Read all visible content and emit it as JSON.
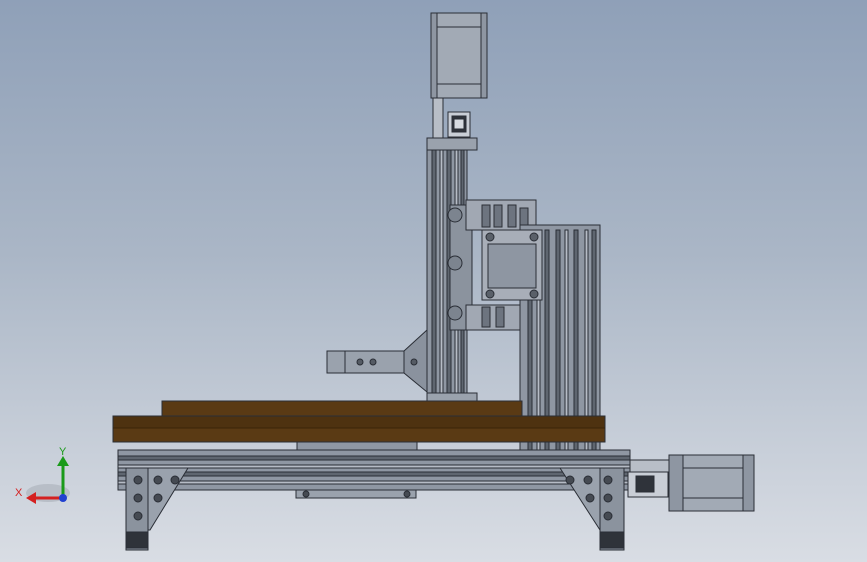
{
  "viewport": {
    "background_top": "#8fa0b8",
    "background_bottom": "#d9dde4",
    "model": "cnc-router-assembly"
  },
  "triad": {
    "x_label": "X",
    "y_label": "Y",
    "x_color": "#d42020",
    "y_color": "#1a9a1a",
    "z_color": "#2040d0"
  },
  "colors": {
    "aluminium": "#9aa2ad",
    "aluminium_dark": "#6c7480",
    "wood": "#5a3a14",
    "wood_dark": "#3a2408",
    "motor": "#8e96a2",
    "outline": "#2a2e36"
  }
}
